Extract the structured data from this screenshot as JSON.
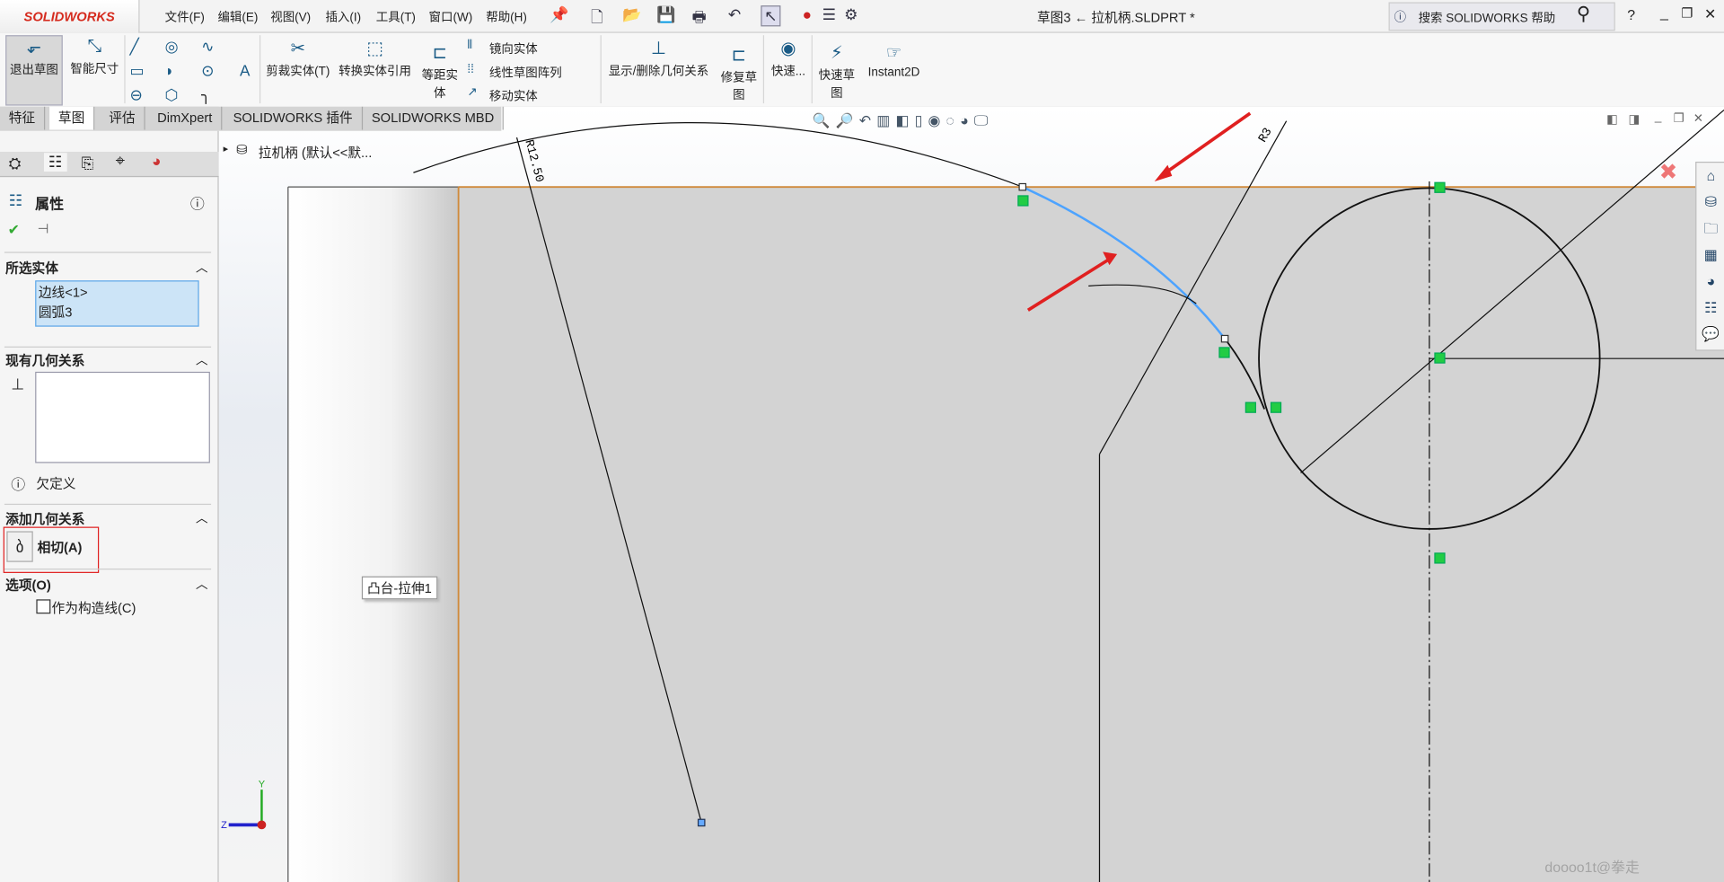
{
  "app": {
    "logo": "SOLIDWORKS",
    "title": "草图3 ← 拉机柄.SLDPRT *",
    "search_placeholder": "搜索 SOLIDWORKS 帮助",
    "help": "?"
  },
  "menu": [
    "文件(F)",
    "编辑(E)",
    "视图(V)",
    "插入(I)",
    "工具(T)",
    "窗口(W)",
    "帮助(H)"
  ],
  "ribbon": {
    "exit_sketch": "退出草图",
    "smart_dim": "智能尺寸",
    "trim": "剪裁实体(T)",
    "convert": "转换实体引用",
    "offset": "等距实体",
    "mirror": "镜向实体",
    "linear_pattern": "线性草图阵列",
    "move": "移动实体",
    "show_relations": "显示/删除几何关系",
    "repair": "修复草图",
    "quick_snap": "快速...",
    "rapid_sketch": "快速草图",
    "instant2d": "Instant2D"
  },
  "tabs": [
    "特征",
    "草图",
    "评估",
    "DimXpert",
    "SOLIDWORKS 插件",
    "SOLIDWORKS MBD"
  ],
  "active_tab": "草图",
  "panel": {
    "title": "属性",
    "selected_header": "所选实体",
    "selected": [
      "边线<1>",
      "圆弧3"
    ],
    "existing_header": "现有几何关系",
    "status": "欠定义",
    "add_header": "添加几何关系",
    "tangent": "相切(A)",
    "options_header": "选项(O)",
    "construction": "作为构造线(C)",
    "construction_checked": false
  },
  "canvas": {
    "tree_item": "拉机柄 (默认<<默...",
    "tooltip": "凸台-拉伸1",
    "dim_r1": "R12.50",
    "dim_r2": "R3",
    "axis_y": "Y",
    "axis_z": "Z",
    "watermark": "doooo1t@拳走"
  },
  "colors": {
    "selected_arc": "#4da3ff",
    "arrow": "#e02020",
    "model_face": "#d3d3d3",
    "edge": "#d08a3c",
    "relation": "#22cc44"
  }
}
